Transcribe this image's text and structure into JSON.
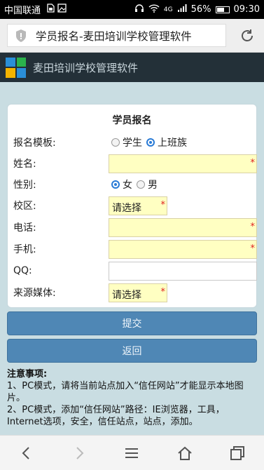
{
  "status_bar": {
    "carrier": "中国联通",
    "network": "4G",
    "battery": "56%",
    "time": "09:30",
    "icons": [
      "sim-icon",
      "image-icon",
      "headphones-icon",
      "wifi-icon",
      "signal-icon",
      "battery-icon"
    ]
  },
  "browser": {
    "page_title": "学员报名-麦田培训学校管理软件",
    "icons": [
      "shield-icon",
      "reload-icon"
    ]
  },
  "app": {
    "title": "麦田培训学校管理软件",
    "colors": {
      "header_bg": "#233038",
      "accent": "#4f87b5",
      "required_bg": "#ffffc2",
      "required_star": "#e02020"
    }
  },
  "form": {
    "title": "学员报名",
    "template_label": "报名模板:",
    "template_options": [
      "学生",
      "上班族"
    ],
    "template_selected": "上班族",
    "name_label": "姓名:",
    "gender_label": "性别:",
    "gender_options": [
      "女",
      "男"
    ],
    "gender_selected": "女",
    "campus_label": "校区:",
    "campus_value": "请选择",
    "phone_label": "电话:",
    "mobile_label": "手机:",
    "qq_label": "QQ:",
    "source_label": "来源媒体:",
    "source_value": "请选择",
    "required_mark": "*"
  },
  "buttons": {
    "submit": "提交",
    "back": "返回"
  },
  "notes": {
    "title": "注意事项:",
    "line1": "1、PC模式，请将当前站点加入“信任网站”才能显示本地图片。",
    "line2": "2、PC模式，添加“信任网站”路径：IE浏览器，工具，Internet选项，安全，信任站点，站点，添加。"
  },
  "nav": {
    "icons": [
      "back-icon",
      "forward-icon",
      "menu-icon",
      "home-icon",
      "tabs-icon"
    ]
  }
}
